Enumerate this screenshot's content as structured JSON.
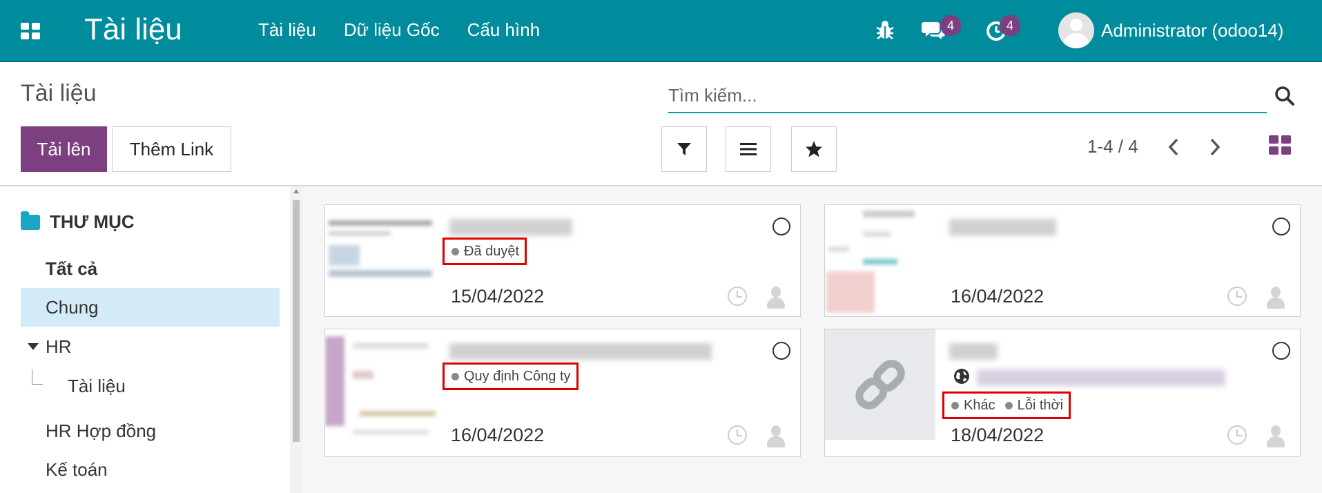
{
  "navbar": {
    "brand": "Tài liệu",
    "menu": [
      "Tài liệu",
      "Dữ liệu Gốc",
      "Cấu hình"
    ],
    "messages_count": "4",
    "activities_count": "4",
    "user_name": "Administrator (odoo14)",
    "icons": [
      "apps-icon",
      "bug-icon",
      "chat-icon",
      "clock-icon"
    ]
  },
  "control_panel": {
    "title": "Tài liệu",
    "search_placeholder": "Tìm kiếm...",
    "upload_label": "Tải lên",
    "add_link_label": "Thêm Link",
    "pager": "1-4 / 4"
  },
  "sidebar": {
    "header": "THƯ MỤC",
    "items": [
      {
        "label": "Tất cả"
      },
      {
        "label": "Chung"
      },
      {
        "label": "HR"
      },
      {
        "label": "Tài liệu"
      },
      {
        "label": "HR Hợp đồng"
      },
      {
        "label": "Kế toán"
      }
    ]
  },
  "cards": [
    {
      "tags": [
        "Đã duyệt"
      ],
      "date": "15/04/2022"
    },
    {
      "tags": [],
      "date": "16/04/2022"
    },
    {
      "tags": [
        "Quy định Công ty"
      ],
      "date": "16/04/2022"
    },
    {
      "tags": [
        "Khác",
        "Lỗi thời"
      ],
      "date": "18/04/2022"
    }
  ],
  "colors": {
    "navbar": "#008c9c",
    "primary": "#7c3f7f",
    "active_folder": "#d3ebf7",
    "highlight_border": "#dd0000"
  }
}
